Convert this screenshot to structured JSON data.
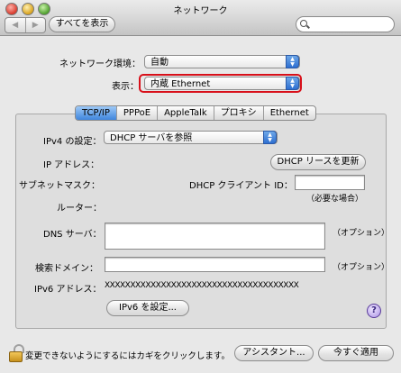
{
  "window": {
    "title": "ネットワーク"
  },
  "toolbar": {
    "back": "◀",
    "forward": "▶",
    "show_all": "すべてを表示",
    "search_placeholder": ""
  },
  "location": {
    "label": "ネットワーク環境：",
    "value": "自動"
  },
  "show": {
    "label": "表示：",
    "value": "内蔵 Ethernet"
  },
  "tabs": [
    {
      "label": "TCP/IP",
      "active": true
    },
    {
      "label": "PPPoE",
      "active": false
    },
    {
      "label": "AppleTalk",
      "active": false
    },
    {
      "label": "プロキシ",
      "active": false
    },
    {
      "label": "Ethernet",
      "active": false
    }
  ],
  "tcpip": {
    "ipv4_label": "IPv4 の設定：",
    "ipv4_value": "DHCP サーバを参照",
    "ip_label": "IP アドレス：",
    "renew_button": "DHCP リースを更新",
    "subnet_label": "サブネットマスク：",
    "client_id_label": "DHCP クライアント ID：",
    "client_id_value": "",
    "client_id_hint": "（必要な場合）",
    "router_label": "ルーター：",
    "dns_label": "DNS サーバ：",
    "dns_value": "",
    "dns_hint": "（オプション）",
    "search_label": "検索ドメイン：",
    "search_value": "",
    "search_hint": "（オプション）",
    "ipv6_label": "IPv6 アドレス：",
    "ipv6_value": "XXXXXXXXXXXXXXXXXXXXXXXXXXXXXXXXXXXXXX",
    "ipv6_button": "IPv6 を設定...",
    "help": "?"
  },
  "footer": {
    "lock_text": "変更できないようにするにはカギをクリックします。",
    "assistant_button": "アシスタント...",
    "apply_button": "今すぐ適用"
  }
}
